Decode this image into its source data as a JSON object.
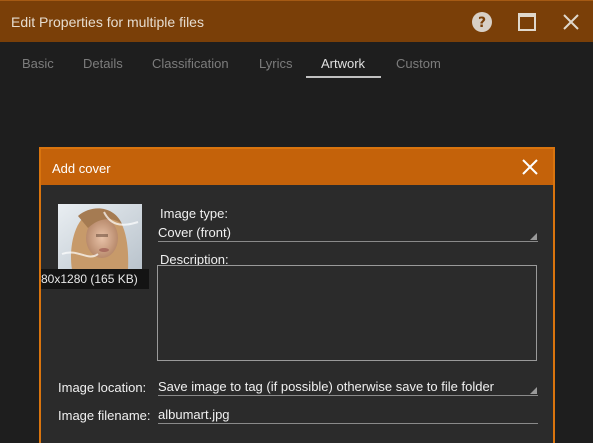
{
  "window": {
    "title": "Edit Properties for multiple files",
    "buttons": {
      "help": "help-icon",
      "maximize": "maximize-icon",
      "close": "close-icon"
    }
  },
  "tabs": [
    {
      "label": "Basic",
      "active": false
    },
    {
      "label": "Details",
      "active": false
    },
    {
      "label": "Classification",
      "active": false
    },
    {
      "label": "Lyrics",
      "active": false
    },
    {
      "label": "Artwork",
      "active": true
    },
    {
      "label": "Custom",
      "active": false
    }
  ],
  "dialog": {
    "title": "Add cover",
    "thumbnail_caption": "80x1280 (165 KB)",
    "image_type": {
      "label": "Image type:",
      "value": "Cover (front)"
    },
    "description": {
      "label": "Description:",
      "value": ""
    },
    "image_location": {
      "label": "Image location:",
      "value": "Save image to tag (if possible) otherwise save to file folder"
    },
    "image_filename": {
      "label": "Image filename:",
      "value": "albumart.jpg"
    }
  },
  "colors": {
    "titlebar": "#7a3f08",
    "dialog_header": "#c4620a",
    "dialog_border": "#d9740e",
    "background": "#1e1e1e"
  }
}
